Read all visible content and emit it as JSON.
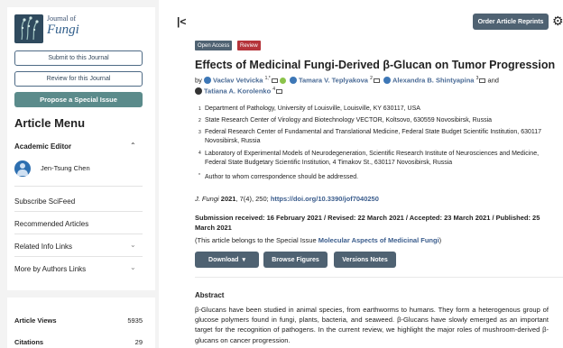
{
  "journal": {
    "logo_line1": "Journal of",
    "logo_line2": "Fungi"
  },
  "sidebar": {
    "submit_label": "Submit to this Journal",
    "review_label": "Review for this Journal",
    "propose_label": "Propose a Special Issue",
    "menu_title": "Article Menu",
    "academic_editor_label": "Academic Editor",
    "editor_name": "Jen-Tsung Chen",
    "links": [
      {
        "label": "Subscribe SciFeed"
      },
      {
        "label": "Recommended Articles"
      },
      {
        "label": "Related Info Links"
      },
      {
        "label": "More by Authors Links"
      }
    ],
    "stats": [
      {
        "label": "Article Views",
        "value": "5935"
      },
      {
        "label": "Citations",
        "value": "29"
      }
    ]
  },
  "header": {
    "order_label": "Order Article Reprints"
  },
  "article": {
    "badges": {
      "open_access": "Open Access",
      "review": "Review"
    },
    "title": "Effects of Medicinal Fungi-Derived β-Glucan on Tumor Progression",
    "by": "by",
    "authors": [
      {
        "name": "Vaclav Vetvicka",
        "sup": "1,*"
      },
      {
        "name": "Tamara V. Teplyakova",
        "sup": "2"
      },
      {
        "name": "Alexandra B. Shintyapina",
        "sup": "3"
      },
      {
        "name": "Tatiana A. Korolenko",
        "sup": "4"
      }
    ],
    "and": "and",
    "affiliations": [
      {
        "num": "1",
        "text": "Department of Pathology, University of Louisville, Louisville, KY 630117, USA"
      },
      {
        "num": "2",
        "text": "State Research Center of Virology and Biotechnology VECTOR, Koltsovo, 630559 Novosibirsk, Russia"
      },
      {
        "num": "3",
        "text": "Federal Research Center of Fundamental and Translational Medicine, Federal State Budget Scientific Institution, 630117 Novosibirsk, Russia"
      },
      {
        "num": "4",
        "text": "Laboratory of Experimental Models of Neurodegeneration, Scientific Research Institute of Neurosciences and Medicine, Federal State Budgetary Scientific Institution, 4 Timakov St., 630117 Novosibirsk, Russia"
      },
      {
        "num": "*",
        "text": "Author to whom correspondence should be addressed."
      }
    ],
    "citation": {
      "journal": "J. Fungi",
      "year": "2021",
      "rest": ", 7(4), 250;",
      "doi": "https://doi.org/10.3390/jof7040250"
    },
    "dates": "Submission received: 16 February 2021 / Revised: 22 March 2021 / Accepted: 23 March 2021 / Published: 25 March 2021",
    "special_issue": {
      "prefix": "(This article belongs to the Special Issue ",
      "name": "Molecular Aspects of Medicinal Fungi",
      "suffix": ")"
    },
    "buttons": {
      "download": "Download",
      "browse": "Browse Figures",
      "versions": "Versions Notes"
    },
    "abstract_heading": "Abstract",
    "abstract_text": "β-Glucans have been studied in animal species, from earthworms to humans. They form a heterogenous group of glucose polymers found in fungi, plants, bacteria, and seaweed. β-Glucans have slowly emerged as an important target for the recognition of pathogens. In the current review, we highlight the major roles of mushroom-derived β-glucans on cancer progression."
  },
  "icons": {
    "collapse": "collapse-sidebar-icon",
    "gear": "gear-icon",
    "caret_up": "chevron-up-icon",
    "caret_down": "chevron-down-icon",
    "email": "email-icon",
    "orcid": "orcid-icon"
  },
  "colors": {
    "primary_button": "#4f6272",
    "teal_button": "#5b8b8b",
    "review_badge": "#b5343a",
    "link": "#3a5c8c"
  }
}
